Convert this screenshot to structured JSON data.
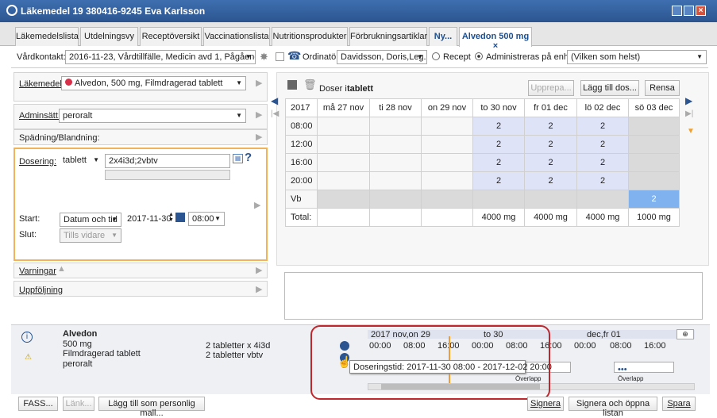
{
  "window": {
    "title": "Läkemedel 19 380416-9245 Eva Karlsson"
  },
  "tabs": [
    "Läkemedelslista",
    "Utdelningsvy",
    "Receptöversikt",
    "Vaccinationslista",
    "Nutritionsprodukter",
    "Förbrukningsartiklar",
    "Ny...",
    "Alvedon 500 mg ×"
  ],
  "context": {
    "vardkontakt_label": "Vårdkontakt:",
    "vardkontakt_value": "2016-11-23, Vårdtillfälle, Medicin avd 1, Pågående",
    "ordinator_label": "Ordinatör:",
    "ordinator_value": "Davidsson, Doris,Leg...",
    "recept_label": "Recept",
    "admin_label": "Administreras på enhet:",
    "admin_value": "(Vilken som helst)"
  },
  "left": {
    "lakemedel_label": "Läkemedel:",
    "lakemedel_value": "Alvedon, 500 mg, Filmdragerad tablett",
    "adminsatt_label": "Adminsätt:",
    "adminsatt_value": "peroralt",
    "spadning_label": "Spädning/Blandning:",
    "dosering_label": "Dosering:",
    "dosering_unit": "tablett",
    "dosering_value": "2x4i3d;2vbtv",
    "start_label": "Start:",
    "start_type": "Datum och tid",
    "start_date": "2017-11-30",
    "start_time": "08:00",
    "slut_label": "Slut:",
    "slut_value": "Tills vidare",
    "varningar_label": "Varningar",
    "uppfoljning_label": "Uppföljning"
  },
  "schedule": {
    "doser_label": "Doser i",
    "doser_unit": "tablett",
    "buttons": [
      "Upprepa...",
      "Lägg till dos...",
      "Rensa"
    ],
    "year": "2017",
    "days": [
      "må 27 nov",
      "ti 28 nov",
      "on 29 nov",
      "to 30 nov",
      "fr 01 dec",
      "lö 02 dec",
      "sö 03 dec"
    ],
    "rows": [
      {
        "label": "08:00",
        "cells": [
          "",
          "",
          "",
          "2",
          "2",
          "2",
          ""
        ]
      },
      {
        "label": "12:00",
        "cells": [
          "",
          "",
          "",
          "2",
          "2",
          "2",
          ""
        ]
      },
      {
        "label": "16:00",
        "cells": [
          "",
          "",
          "",
          "2",
          "2",
          "2",
          ""
        ]
      },
      {
        "label": "20:00",
        "cells": [
          "",
          "",
          "",
          "2",
          "2",
          "2",
          ""
        ]
      },
      {
        "label": "Vb",
        "cells": [
          "",
          "",
          "",
          "",
          "",
          "",
          "2"
        ]
      },
      {
        "label": "Total:",
        "cells": [
          "",
          "",
          "",
          "4000 mg",
          "4000 mg",
          "4000 mg",
          "1000 mg"
        ]
      }
    ]
  },
  "bottom": {
    "drug_name": "Alvedon",
    "drug_strength": "500 mg",
    "drug_form": "Filmdragerad tablett",
    "drug_route": "peroralt",
    "dose1": "2 tabletter x 4i3d",
    "dose2": "2 tabletter vbtv",
    "timeline_date1": "2017 nov,on 29",
    "timeline_date2": "to 30",
    "timeline_date3": "dec,fr 01",
    "timeline_times": [
      "00:00",
      "08:00",
      "16:00",
      "00:00",
      "08:00",
      "16:00",
      "00:00",
      "08:00",
      "16:00"
    ],
    "tooltip": "Doseringstid: 2017-11-30 08:00 - 2017-12-02 20:00",
    "overlapp": "Överlapp",
    "dots": "•••"
  },
  "footer": {
    "fass": "FASS...",
    "lank": "Länk...",
    "mall": "Lägg till som personlig mall...",
    "signera": "Signera",
    "signera_oppna": "Signera och öppna listan",
    "spara": "Spara"
  }
}
